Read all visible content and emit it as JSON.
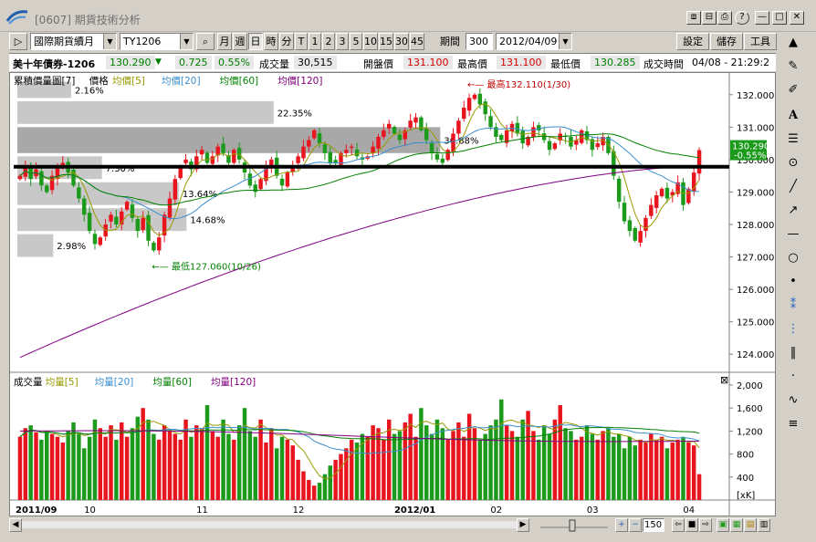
{
  "window": {
    "title": "[0607] 期貨技術分析",
    "buttons": [
      "⧈",
      "⊟",
      "?",
      "—",
      "□",
      "✕"
    ]
  },
  "toolbar": {
    "play_label": "▷",
    "market": "國際期貨續月",
    "symbol": "TY1206",
    "periods": [
      "月",
      "週",
      "日",
      "時",
      "分",
      "T",
      "1",
      "2",
      "3",
      "5",
      "10",
      "15",
      "30",
      "45"
    ],
    "selected_period": "日",
    "count_label": "期間",
    "count": "300",
    "date": "2012/04/09",
    "settings": "設定",
    "save": "儲存",
    "tools": "工具"
  },
  "quote": {
    "name": "美十年債券-1206",
    "price": "130.290",
    "change": "0.725",
    "change_pct": "0.55%",
    "volume_label": "成交量",
    "volume": "30,515",
    "open_label": "開盤價",
    "open": "131.100",
    "high_label": "最高價",
    "high": "131.100",
    "low_label": "最低價",
    "low": "130.285",
    "time_label": "成交時間",
    "time": "04/08 - 21:29:2"
  },
  "price_panel": {
    "legend": [
      {
        "text": "累積價量圖[7]",
        "color": "#000000"
      },
      {
        "text": "價格",
        "color": "#000000"
      },
      {
        "text": "均價[5]",
        "color": "#999900"
      },
      {
        "text": "均價[20]",
        "color": "#3a8fd0"
      },
      {
        "text": "均價[60]",
        "color": "#008000"
      },
      {
        "text": "均價[120]",
        "color": "#800080"
      }
    ],
    "high_note": "最高132.110(1/30)",
    "low_note": "最低127.060(10/26)",
    "last_price": "130.290",
    "last_change": "-0.55%",
    "profile": [
      {
        "pct": "2.16%",
        "frac": 0.21
      },
      {
        "pct": "22.35%",
        "frac": 1.0
      },
      {
        "pct": "36.88%",
        "frac": 1.65
      },
      {
        "pct": "7.30%",
        "frac": 0.33
      },
      {
        "pct": "13.64%",
        "frac": 0.63
      },
      {
        "pct": "14.68%",
        "frac": 0.66
      },
      {
        "pct": "2.98%",
        "frac": 0.14
      }
    ]
  },
  "volume_panel": {
    "legend": [
      {
        "text": "成交量",
        "color": "#000000"
      },
      {
        "text": "均量[5]",
        "color": "#999900"
      },
      {
        "text": "均量[20]",
        "color": "#3a8fd0"
      },
      {
        "text": "均量[60]",
        "color": "#008000"
      },
      {
        "text": "均量[120]",
        "color": "#800080"
      }
    ],
    "unit": "[xK]",
    "close_icon": "⊠"
  },
  "x_labels": [
    "2011/09",
    "10",
    "11",
    "12",
    "2012/01",
    "02",
    "03",
    "04"
  ],
  "statusbar": {
    "zoom": "150"
  },
  "colors": {
    "up": "#e8141e",
    "down": "#1c9a1c",
    "ma5": "#999900",
    "ma20": "#3a8fd0",
    "ma60": "#008000",
    "ma120": "#800080",
    "profile": "#c8c8c8",
    "profile_peak": "#a8a8a8"
  },
  "chart_data": {
    "type": "candlestick",
    "title": "美十年債券-1206",
    "ylim": [
      123.5,
      132.5
    ],
    "yticks": [
      124,
      125,
      126,
      127,
      128,
      129,
      130,
      131,
      132
    ],
    "volume_ylim": [
      0,
      2000
    ],
    "volume_yticks": [
      400,
      800,
      1200,
      1600,
      2000
    ],
    "high": {
      "value": 132.11,
      "date": "1/30"
    },
    "low": {
      "value": 127.06,
      "date": "10/26"
    },
    "last": 130.29,
    "close_path": [
      129.5,
      129.8,
      129.4,
      129.7,
      129.2,
      129.0,
      129.5,
      129.8,
      129.9,
      129.6,
      129.2,
      128.8,
      128.3,
      127.8,
      127.4,
      127.6,
      128.0,
      128.3,
      128.0,
      128.4,
      128.7,
      128.2,
      127.8,
      128.2,
      127.5,
      127.2,
      127.6,
      128.3,
      128.8,
      129.4,
      129.8,
      130.0,
      129.7,
      130.1,
      130.3,
      129.9,
      130.1,
      130.4,
      130.2,
      129.9,
      130.3,
      130.0,
      129.6,
      129.2,
      129.0,
      129.4,
      129.8,
      130.0,
      129.5,
      129.2,
      129.6,
      129.8,
      130.1,
      130.4,
      130.6,
      130.9,
      130.5,
      130.2,
      129.9,
      129.9,
      130.2,
      130.3,
      130.4,
      130.1,
      130.0,
      130.1,
      130.4,
      130.7,
      130.9,
      131.1,
      130.8,
      130.6,
      130.9,
      131.2,
      131.3,
      130.9,
      130.6,
      130.2,
      130.0,
      129.9,
      130.3,
      130.8,
      131.2,
      131.6,
      131.9,
      132.0,
      131.7,
      131.4,
      131.0,
      130.7,
      130.6,
      130.9,
      131.1,
      130.8,
      130.5,
      130.7,
      131.0,
      130.9,
      130.6,
      130.3,
      130.5,
      130.8,
      130.7,
      130.4,
      130.6,
      130.9,
      130.6,
      130.3,
      130.5,
      130.7,
      130.2,
      129.5,
      128.7,
      128.1,
      127.8,
      127.5,
      127.8,
      128.2,
      128.6,
      128.9,
      129.1,
      128.8,
      129.0,
      129.3,
      128.6,
      129.1,
      129.6,
      130.29
    ],
    "volume_path": [
      1100,
      1250,
      1300,
      1180,
      1050,
      1200,
      1150,
      1100,
      1000,
      1200,
      1350,
      1150,
      900,
      1100,
      1400,
      1250,
      1100,
      1300,
      1050,
      1350,
      1100,
      1250,
      1450,
      1600,
      1400,
      1150,
      1050,
      1300,
      1200,
      1150,
      1050,
      1400,
      1100,
      1300,
      1250,
      1650,
      1200,
      1100,
      1400,
      1150,
      1050,
      1300,
      1600,
      1200,
      1100,
      1400,
      1000,
      1250,
      900,
      1100,
      1050,
      950,
      700,
      500,
      350,
      250,
      300,
      450,
      600,
      700,
      800,
      900,
      1050,
      1000,
      1150,
      1100,
      1300,
      1250,
      1050,
      1400,
      1150,
      1200,
      1350,
      1500,
      1100,
      1600,
      1300,
      1150,
      1400,
      1250,
      1050,
      1200,
      1350,
      1100,
      1500,
      1250,
      1050,
      1150,
      1300,
      1400,
      1750,
      1300,
      1200,
      1100,
      1400,
      1550,
      1200,
      1050,
      1300,
      1150,
      1400,
      1650,
      1250,
      1200,
      1050,
      1100,
      1300,
      1150,
      1050,
      1200,
      1250,
      1100,
      1150,
      900,
      1100,
      950,
      1050,
      1000,
      1150,
      1050,
      1100,
      900,
      1000,
      1050,
      1100,
      1000,
      950,
      450
    ]
  }
}
